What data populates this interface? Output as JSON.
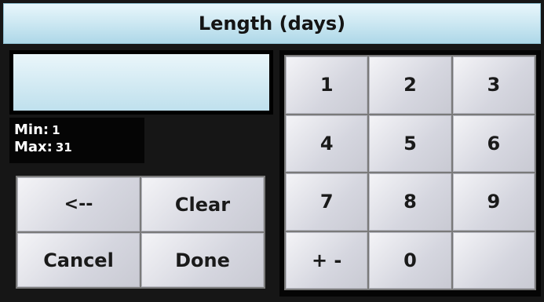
{
  "header": {
    "title": "Length (days)"
  },
  "display": {
    "value": ""
  },
  "range": {
    "min_label": "Min:",
    "min_value": "1",
    "max_label": "Max:",
    "max_value": "31"
  },
  "actions": {
    "backspace": "<--",
    "clear": "Clear",
    "cancel": "Cancel",
    "done": "Done"
  },
  "keypad": {
    "k1": "1",
    "k2": "2",
    "k3": "3",
    "k4": "4",
    "k5": "5",
    "k6": "6",
    "k7": "7",
    "k8": "8",
    "k9": "9",
    "sign": "+ -",
    "k0": "0",
    "blank": ""
  }
}
